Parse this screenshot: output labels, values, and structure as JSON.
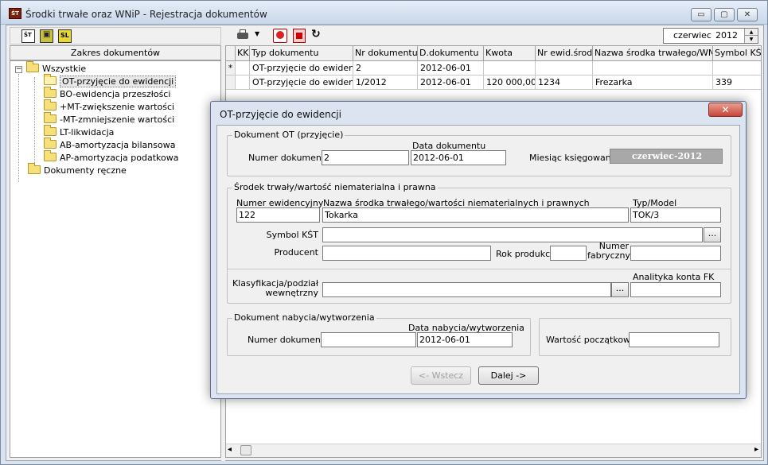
{
  "window": {
    "title": "Środki trwałe oraz WNiP - Rejestracja dokumentów",
    "app_icon_text": "ŚT",
    "min_glyph": "▭",
    "max_glyph": "▢",
    "close_glyph": "✕"
  },
  "left_toolbar": {
    "buttons": [
      {
        "icon": "document-st-icon",
        "text": "ŚT"
      },
      {
        "icon": "calculator-icon",
        "text": "▣"
      },
      {
        "icon": "sl-icon",
        "text": "SL"
      }
    ]
  },
  "left_panel": {
    "header": "Zakres dokumentów",
    "tree": {
      "root": "Wszystkie",
      "expander": "−",
      "items": [
        "OT-przyjęcie do ewidencji",
        "BO-ewidencja przeszłości",
        "+MT-zwiększenie wartości",
        "-MT-zmniejszenie wartości",
        "LT-likwidacja",
        "AB-amortyzacja bilansowa",
        "AP-amortyzacja podatkowa"
      ],
      "other": "Dokumenty ręczne"
    }
  },
  "right_toolbar": {
    "period_month": "czerwiec",
    "period_year": "2012",
    "spin_up": "▲",
    "spin_down": "▼",
    "dropdown_glyph": "▼",
    "refresh_glyph": "↻"
  },
  "grid": {
    "columns": [
      "KK",
      "Typ dokumentu",
      "Nr dokumentu",
      "D.dokumentu",
      "Kwota",
      "Nr ewid.środka",
      "Nazwa środka trwałego/WNiP",
      "Symbol KŚT"
    ],
    "new_row_marker": "*",
    "rows": [
      {
        "typ": "OT-przyjęcie do ewidencji",
        "nr": "2",
        "data": "2012-06-01",
        "kwota": "",
        "nr_ewid": "",
        "nazwa": "",
        "kst": ""
      },
      {
        "typ": "OT-przyjęcie do ewidencji",
        "nr": "1/2012",
        "data": "2012-06-01",
        "kwota": "120 000,00",
        "nr_ewid": "1234",
        "nazwa": "Frezarka",
        "kst": "339"
      }
    ],
    "scroll_left": "◂",
    "scroll_right": "▸"
  },
  "dialog": {
    "title": "OT-przyjęcie do ewidencji",
    "close_glyph": "✕",
    "doc_group": {
      "legend": "Dokument OT (przyjęcie)",
      "nr_label": "Numer dokumentu",
      "nr_value": "2",
      "date_label": "Data dokumentu",
      "date_value": "2012-06-01",
      "month_label": "Miesiąc księgowania",
      "month_value": "czerwiec-2012"
    },
    "asset_group": {
      "legend": "Środek trwały/wartość niematerialna i prawna",
      "ewid_label": "Numer ewidencyjny",
      "ewid_value": "122",
      "name_label": "Nazwa środka trwałego/wartości niematerialnych i prawnych",
      "name_value": "Tokarka",
      "model_label": "Typ/Model",
      "model_value": "TOK/3",
      "kst_label": "Symbol KŚT",
      "kst_value": "",
      "producer_label": "Producent",
      "producer_value": "",
      "year_label": "Rok produkcji",
      "year_value": "",
      "serial_label_1": "Numer",
      "serial_label_2": "fabryczny",
      "serial_value": "",
      "class_label_1": "Klasyfikacja/podział",
      "class_label_2": "wewnętrzny",
      "class_value": "",
      "fk_label": "Analityka konta FK",
      "fk_value": "",
      "dots": "..."
    },
    "acq_group": {
      "legend": "Dokument nabycia/wytworzenia",
      "nr_label": "Numer dokumentu",
      "nr_value": "",
      "date_label": "Data nabycia/wytworzenia",
      "date_value": "2012-06-01"
    },
    "value_group": {
      "label": "Wartość początkowa",
      "value": ""
    },
    "back_button": "<- Wstecz",
    "next_button": "Dalej ->"
  }
}
